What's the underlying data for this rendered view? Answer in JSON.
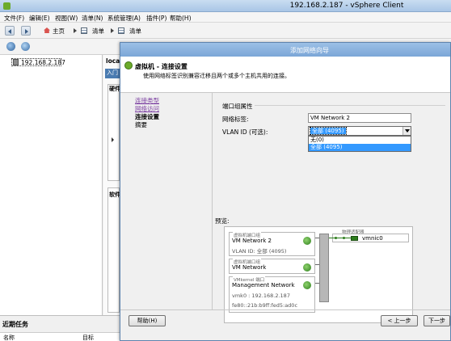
{
  "app": {
    "title": "192.168.2.187 - vSphere Client",
    "menu": [
      "文件(F)",
      "编辑(E)",
      "视图(W)",
      "清单(N)",
      "系统管理(A)",
      "插件(P)",
      "帮助(H)"
    ]
  },
  "toolbar": {
    "breadcrumb": [
      "主页",
      "清单",
      "清单"
    ]
  },
  "inventory": {
    "host": "192.168.2.187"
  },
  "background_tabs": {
    "host_tab": "local",
    "sub_tab": "入门",
    "hardware": "硬件",
    "software": "软件"
  },
  "recent_tasks": {
    "title": "近期任务",
    "columns": [
      "名称",
      "目标"
    ]
  },
  "dialog": {
    "title": "添加网络向导",
    "heading": "虚拟机 - 连接设置",
    "description": "使用网络标签识别兼容迁移且两个或多个主机共用的连接。",
    "steps": [
      {
        "label": "连接类型",
        "state": "link"
      },
      {
        "label": "网络访问",
        "state": "link"
      },
      {
        "label": "连接设置",
        "state": "current"
      },
      {
        "label": "摘要",
        "state": "pending"
      }
    ],
    "port_group": {
      "legend": "端口组属性",
      "network_label_caption": "网络标签:",
      "network_label_value": "VM Network 2",
      "vlan_caption": "VLAN ID (可选):",
      "vlan_selected": "全部 (4095)",
      "vlan_options": [
        "无(0)",
        "全部 (4095)"
      ]
    },
    "preview": {
      "label": "预览:",
      "port_groups": [
        {
          "category": "虚拟机端口组",
          "name": "VM Network 2",
          "detail": [
            "VLAN ID: 全部 (4095)"
          ]
        },
        {
          "category": "虚拟机端口组",
          "name": "VM Network",
          "detail": []
        },
        {
          "category": "VMkernel 端口",
          "name": "Management Network",
          "detail": [
            "vmk0 : 192.168.2.187",
            "fe80::21b:b9ff:fed5:ad0c"
          ]
        }
      ],
      "adapters_category": "物理适配器",
      "adapter": "vmnic0"
    },
    "buttons": {
      "help": "帮助(H)",
      "back": "< 上一步",
      "next": "下一步"
    }
  }
}
